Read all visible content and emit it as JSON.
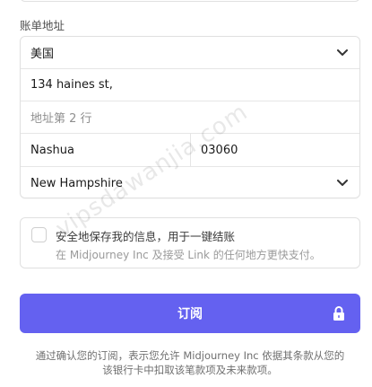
{
  "billing": {
    "section_label": "账单地址",
    "country_value": "美国",
    "address_line1_value": "134 haines st,",
    "address_line2_placeholder": "地址第 2 行",
    "city_value": "Nashua",
    "zip_value": "03060",
    "state_value": "New Hampshire"
  },
  "save_info": {
    "checked": false,
    "title": "安全地保存我的信息，用于一键结账",
    "subtitle": "在 Midjourney Inc 及接受 Link 的任何地方更快支付。"
  },
  "subscribe": {
    "label": "订阅",
    "icon": "lock-icon"
  },
  "terms": {
    "line1": "通过确认您的订阅，表示您允许 Midjourney Inc 依据其条款从您的",
    "line2": "该银行卡中扣取该笔款项及未来款项。"
  },
  "watermark": {
    "text": "vipsdawanjia.com"
  },
  "colors": {
    "accent": "#6461f0",
    "border": "#e0e0e0"
  }
}
